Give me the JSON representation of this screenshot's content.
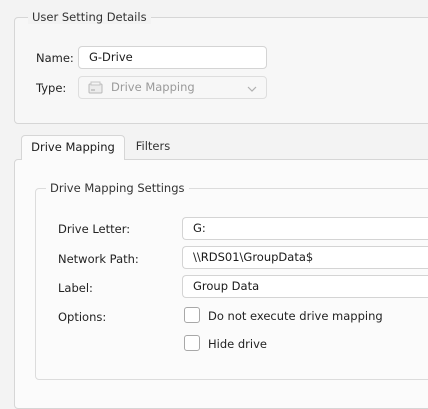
{
  "user_setting": {
    "legend": "User Setting Details",
    "name_label": "Name:",
    "name_value": "G-Drive",
    "type_label": "Type:",
    "type_value": "Drive Mapping",
    "type_icon": "drive-mapping-icon"
  },
  "tabs": [
    {
      "label": "Drive Mapping",
      "active": true
    },
    {
      "label": "Filters",
      "active": false
    }
  ],
  "drive_mapping": {
    "legend": "Drive Mapping Settings",
    "drive_letter_label": "Drive Letter:",
    "drive_letter_value": "G:",
    "network_path_label": "Network Path:",
    "network_path_value": "\\\\RDS01\\GroupData$",
    "label_label": "Label:",
    "label_value": "Group Data",
    "options_label": "Options:",
    "option_no_execute": {
      "label": "Do not execute drive mapping",
      "checked": false
    },
    "option_hide_drive": {
      "label": "Hide drive",
      "checked": false
    }
  },
  "colors": {
    "background": "#f3f3f3",
    "panel": "#fbfbfb",
    "border": "#d6d6d6",
    "disabled_text": "#9a9a9a"
  }
}
